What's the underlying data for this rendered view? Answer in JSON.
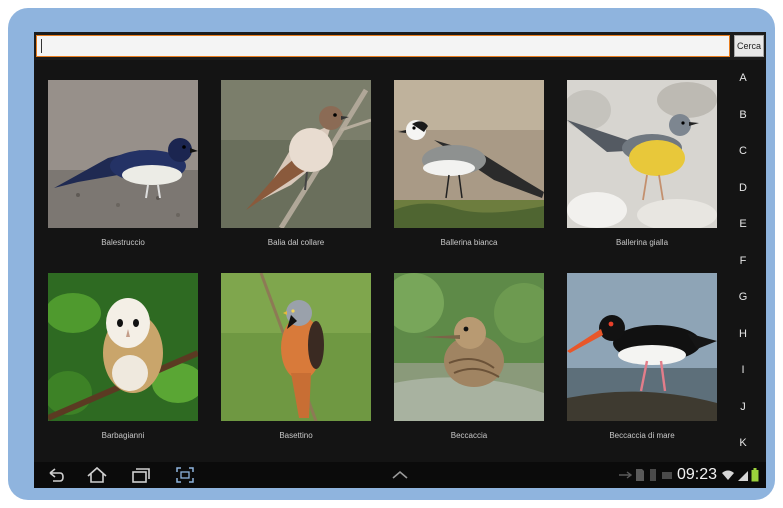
{
  "search": {
    "placeholder": "",
    "value": "",
    "button_label": "Cerca"
  },
  "birds": [
    {
      "name": "Balestruccio",
      "icon": "house-martin-photo"
    },
    {
      "name": "Balia dal collare",
      "icon": "collared-flycatcher-photo"
    },
    {
      "name": "Ballerina bianca",
      "icon": "white-wagtail-photo"
    },
    {
      "name": "Ballerina gialla",
      "icon": "grey-wagtail-photo"
    },
    {
      "name": "Barbagianni",
      "icon": "barn-owl-photo"
    },
    {
      "name": "Basettino",
      "icon": "bearded-reedling-photo"
    },
    {
      "name": "Beccaccia",
      "icon": "woodcock-photo"
    },
    {
      "name": "Beccaccia di mare",
      "icon": "oystercatcher-photo"
    }
  ],
  "index_letters": [
    "A",
    "B",
    "C",
    "D",
    "E",
    "F",
    "G",
    "H",
    "I",
    "J",
    "K"
  ],
  "status_bar": {
    "time": "09:23"
  },
  "colors": {
    "frame": "#8fb4de",
    "accent": "#e87d1e",
    "screen": "#141414",
    "battery": "#9bd23c"
  }
}
